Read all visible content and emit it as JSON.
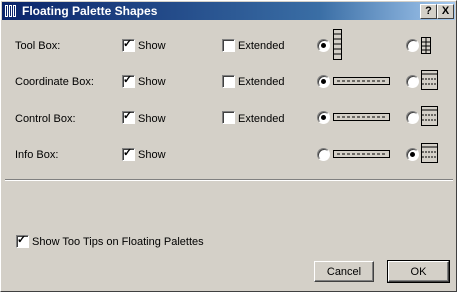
{
  "window": {
    "title": "Floating Palette Shapes",
    "help_label": "?",
    "close_label": "X",
    "titlebar_color": "#0a246a"
  },
  "rows": [
    {
      "label": "Tool Box:",
      "show_label": "Show",
      "show_checked": true,
      "extended_label": "Extended",
      "extended_checked": false,
      "selected_option": "vertical"
    },
    {
      "label": "Coordinate Box:",
      "show_label": "Show",
      "show_checked": true,
      "extended_label": "Extended",
      "extended_checked": false,
      "selected_option": "horizontal"
    },
    {
      "label": "Control Box:",
      "show_label": "Show",
      "show_checked": true,
      "extended_label": "Extended",
      "extended_checked": false,
      "selected_option": "horizontal"
    },
    {
      "label": "Info Box:",
      "show_label": "Show",
      "show_checked": true,
      "extended_label": null,
      "extended_checked": null,
      "selected_option": "grid"
    }
  ],
  "tooltips": {
    "label": "Show Too Tips on Floating Palettes",
    "checked": true
  },
  "buttons": {
    "cancel": "Cancel",
    "ok": "OK"
  }
}
